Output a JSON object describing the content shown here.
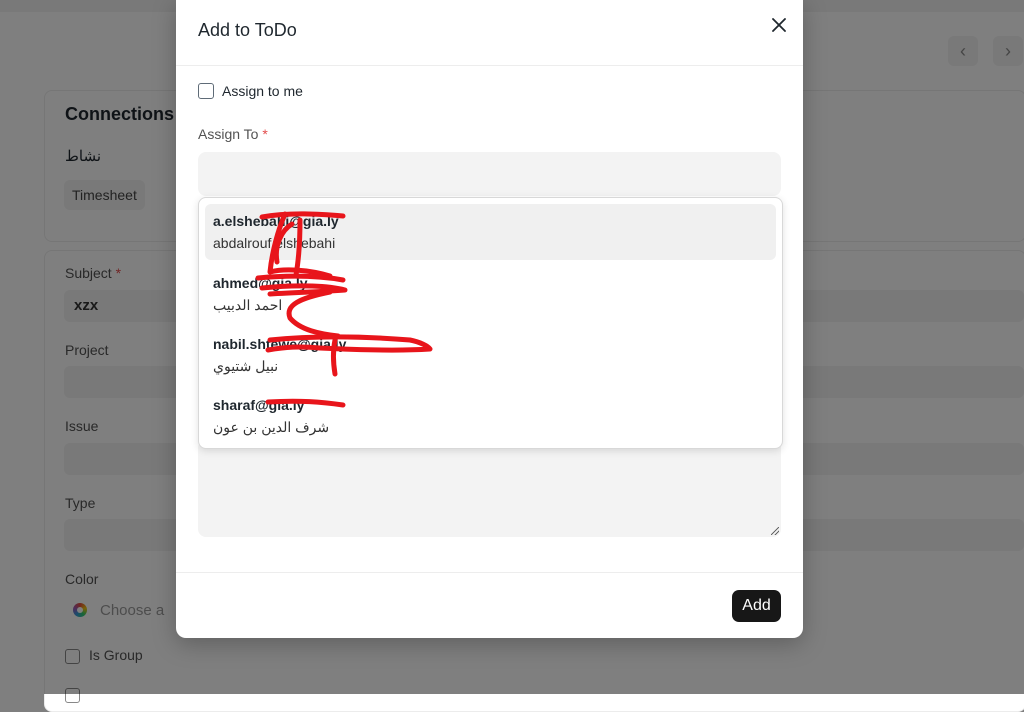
{
  "background": {
    "connections_title": "Connections",
    "activity_label": "نشاط",
    "timesheet_chip": "Timesheet",
    "subject_label": "Subject",
    "subject_value": "xzx",
    "project_label": "Project",
    "issue_label": "Issue",
    "type_label": "Type",
    "color_label": "Color",
    "color_placeholder": "Choose a",
    "is_group_label": "Is Group",
    "prev_icon": "chevron-left-icon",
    "next_icon": "chevron-right-icon"
  },
  "modal": {
    "title": "Add to ToDo",
    "close_icon": "close-icon",
    "assign_to_me_label": "Assign to me",
    "assign_to_me_checked": false,
    "assign_to_label": "Assign To",
    "required_mark": "*",
    "assign_to_value": "",
    "dropdown_items": [
      {
        "primary": "a.elshebahi@gia.ly",
        "secondary": "abdalrouf elshebahi",
        "active": true
      },
      {
        "primary": "ahmed@gia.ly",
        "secondary": "احمد الدبيب",
        "active": false
      },
      {
        "primary": "nabil.shtewe@gia.ly",
        "secondary": "نبيل شتيوي",
        "active": false
      },
      {
        "primary": "sharaf@gia.ly",
        "secondary": "شرف الدين بن عون",
        "active": false
      }
    ],
    "add_button_label": "Add"
  },
  "colors": {
    "overlay": "rgba(0,0,0,0.5)",
    "primary_button": "#171717",
    "required": "#e24c4c",
    "scribble": "#e8151b"
  }
}
